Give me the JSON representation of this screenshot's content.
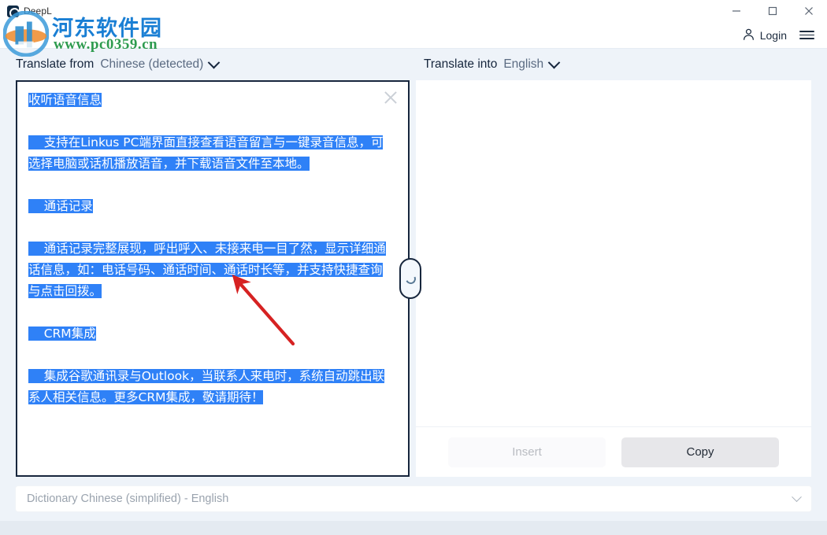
{
  "window": {
    "app_title": "DeepL",
    "app_icon": "deepl-icon",
    "minimize": "minimize-icon",
    "maximize": "maximize-icon",
    "close": "close-icon"
  },
  "header": {
    "login_label": "Login",
    "login_icon": "person-icon",
    "menu_icon": "hamburger-menu-icon"
  },
  "lang": {
    "source_prefix": "Translate from",
    "source_value": "Chinese (detected)",
    "target_prefix": "Translate into",
    "target_value": "English"
  },
  "source": {
    "clear_icon": "close-icon",
    "paragraphs": [
      {
        "text": "收听语音信息",
        "selected": true
      },
      {
        "text": "",
        "selected": false
      },
      {
        "text": "    支持在Linkus PC端界面直接查看语音留言与一键录音信息，可选择电脑或话机播放语音，并下载语音文件至本地。",
        "selected": true
      },
      {
        "text": "",
        "selected": false
      },
      {
        "text": "    通话记录",
        "selected": true
      },
      {
        "text": "",
        "selected": false
      },
      {
        "text": "    通话记录完整展现，呼出呼入、未接来电一目了然，显示详细通话信息，如：电话号码、通话时间、通话时长等，并支持快捷查询与点击回拨。",
        "selected": true
      },
      {
        "text": "",
        "selected": false
      },
      {
        "text": "    CRM集成",
        "selected": true
      },
      {
        "text": "",
        "selected": false
      },
      {
        "text": "    集成谷歌通讯录与Outlook，当联系人来电时，系统自动跳出联系人相关信息。更多CRM集成，敬请期待！",
        "selected": true
      }
    ]
  },
  "target": {
    "text": "",
    "insert_label": "Insert",
    "copy_label": "Copy"
  },
  "status": {
    "spinner_icon": "loading-spinner-icon"
  },
  "dictionary": {
    "label": "Dictionary Chinese (simplified) - English",
    "chevron_icon": "chevron-down-icon"
  },
  "watermark": {
    "site_name": "河东软件园",
    "site_url": "www.pc0359.cn",
    "logo_icon": "pc0359-logo-icon"
  },
  "annotation": {
    "arrow_icon": "red-arrow-icon",
    "color": "#d62222"
  },
  "colors": {
    "selection_blue": "#2f81f7",
    "panel_border": "#17263d",
    "app_background": "#eef3f9",
    "accent_site": "#1a7fd4",
    "accent_url": "#2e9b4f"
  }
}
